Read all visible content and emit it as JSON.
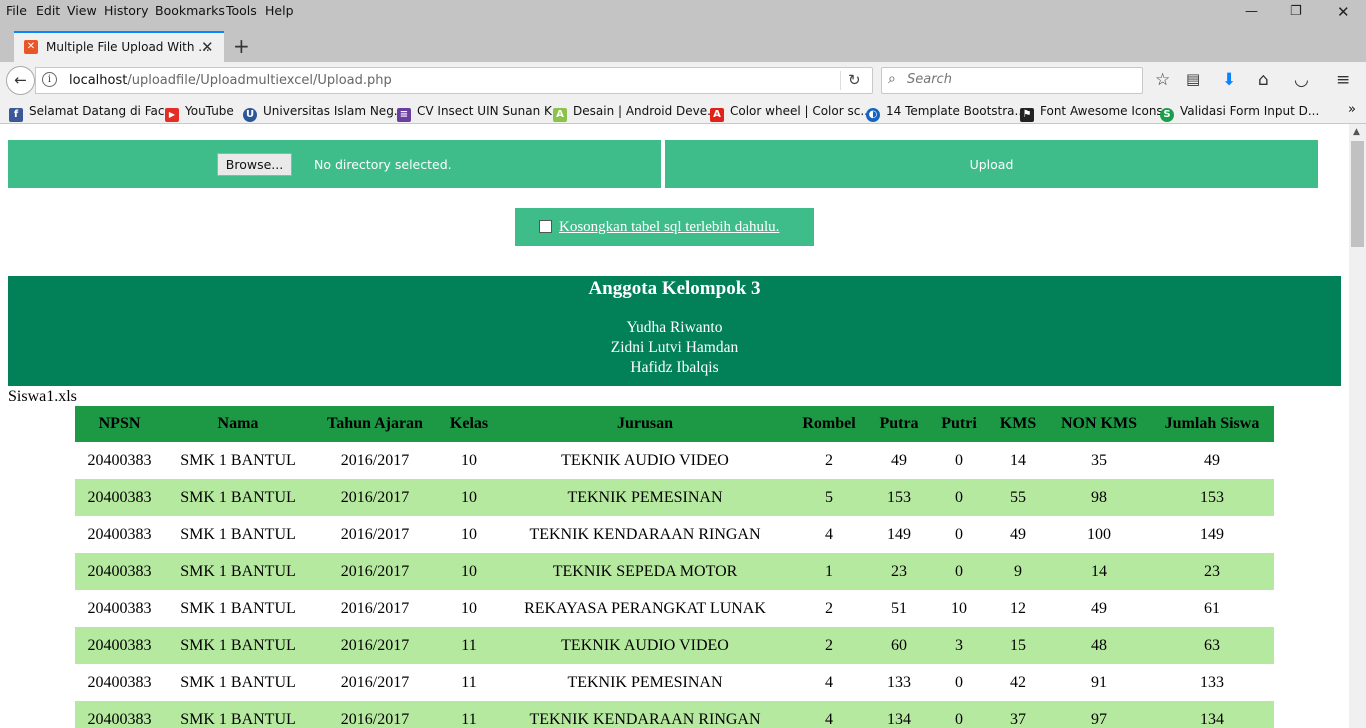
{
  "menubar": {
    "items": [
      "File",
      "Edit",
      "View",
      "History",
      "Bookmarks",
      "Tools",
      "Help"
    ]
  },
  "window_controls": {
    "minimize": "—",
    "restore": "❐",
    "close": "✕"
  },
  "tab": {
    "title": "Multiple File Upload With ...",
    "close": "✕",
    "new_tab": "+"
  },
  "navbar": {
    "url_host": "localhost",
    "url_path": "/uploadfile/Uploadmultiexcel/Upload.php",
    "search_placeholder": "Search"
  },
  "bookmarks": [
    {
      "label": "Selamat Datang di Fac...",
      "icon": "facebook-icon",
      "color": "#3b5998",
      "glyph": "f"
    },
    {
      "label": "YouTube",
      "icon": "youtube-icon",
      "color": "#e52d27",
      "glyph": "▶"
    },
    {
      "label": "Universitas Islam Neg...",
      "icon": "university-icon",
      "color": "#2b5797",
      "glyph": "U"
    },
    {
      "label": "CV Insect UIN Sunan K...",
      "icon": "document-icon",
      "color": "#6a3fa0",
      "glyph": "≡"
    },
    {
      "label": "Desain | Android Deve...",
      "icon": "android-icon",
      "color": "#8bc34a",
      "glyph": "A"
    },
    {
      "label": "Color wheel | Color sc...",
      "icon": "adobe-icon",
      "color": "#e0221b",
      "glyph": "A"
    },
    {
      "label": "14 Template Bootstra...",
      "icon": "globe-icon",
      "color": "#1565c0",
      "glyph": "◐"
    },
    {
      "label": "Font Awesome Icons",
      "icon": "font-awesome-icon",
      "color": "#222222",
      "glyph": "⚑"
    },
    {
      "label": "Validasi Form Input D...",
      "icon": "s-logo-icon",
      "color": "#1b9e4b",
      "glyph": "S"
    }
  ],
  "upload": {
    "browse_label": "Browse...",
    "no_dir_text": "No directory selected.",
    "upload_label": "Upload",
    "truncate_label": "Kosongkan tabel sql terlebih dahulu."
  },
  "team": {
    "heading": "Anggota Kelompok 3",
    "members": [
      "Yudha Riwanto",
      "Zidni Lutvi Hamdan",
      "Hafidz Ibalqis"
    ]
  },
  "file_name": "Siswa1.xls",
  "table": {
    "headers": [
      "NPSN",
      "Nama",
      "Tahun Ajaran",
      "Kelas",
      "Jurusan",
      "Rombel",
      "Putra",
      "Putri",
      "KMS",
      "NON KMS",
      "Jumlah Siswa"
    ],
    "rows": [
      [
        "20400383",
        "SMK 1 BANTUL",
        "2016/2017",
        "10",
        "TEKNIK AUDIO VIDEO",
        "2",
        "49",
        "0",
        "14",
        "35",
        "49"
      ],
      [
        "20400383",
        "SMK 1 BANTUL",
        "2016/2017",
        "10",
        "TEKNIK PEMESINAN",
        "5",
        "153",
        "0",
        "55",
        "98",
        "153"
      ],
      [
        "20400383",
        "SMK 1 BANTUL",
        "2016/2017",
        "10",
        "TEKNIK KENDARAAN RINGAN",
        "4",
        "149",
        "0",
        "49",
        "100",
        "149"
      ],
      [
        "20400383",
        "SMK 1 BANTUL",
        "2016/2017",
        "10",
        "TEKNIK SEPEDA MOTOR",
        "1",
        "23",
        "0",
        "9",
        "14",
        "23"
      ],
      [
        "20400383",
        "SMK 1 BANTUL",
        "2016/2017",
        "10",
        "REKAYASA PERANGKAT LUNAK",
        "2",
        "51",
        "10",
        "12",
        "49",
        "61"
      ],
      [
        "20400383",
        "SMK 1 BANTUL",
        "2016/2017",
        "11",
        "TEKNIK AUDIO VIDEO",
        "2",
        "60",
        "3",
        "15",
        "48",
        "63"
      ],
      [
        "20400383",
        "SMK 1 BANTUL",
        "2016/2017",
        "11",
        "TEKNIK PEMESINAN",
        "4",
        "133",
        "0",
        "42",
        "91",
        "133"
      ],
      [
        "20400383",
        "SMK 1 BANTUL",
        "2016/2017",
        "11",
        "TEKNIK KENDARAAN RINGAN",
        "4",
        "134",
        "0",
        "37",
        "97",
        "134"
      ]
    ]
  },
  "colors": {
    "panel_green": "#3ebc8a",
    "team_green": "#028058",
    "header_green": "#1d9946",
    "row_alt": "#b6e9a0"
  }
}
